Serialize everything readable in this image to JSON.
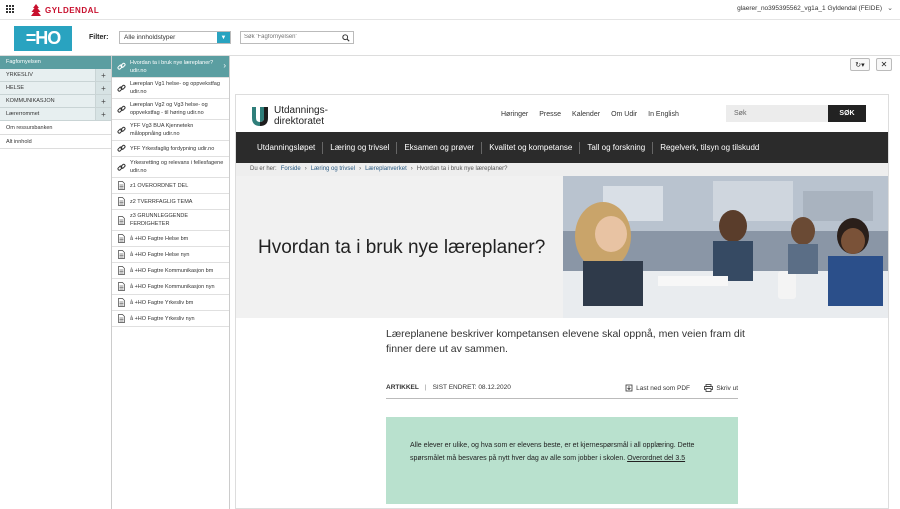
{
  "topbar": {
    "brand": "GYLDENDAL",
    "user": "glaerer_no395395562_vg1a_1 Gyldendal (FEIDE)"
  },
  "filterbar": {
    "logo_text": "=HO",
    "filter_label": "Filter:",
    "filter_value": "Alle innholdstyper",
    "search_placeholder": "Søk 'Fagfornyelsen'"
  },
  "nav": {
    "header": "Fagfornyelsen",
    "groups": [
      {
        "label": "YRKESLIV"
      },
      {
        "label": "HELSE"
      },
      {
        "label": "KOMMUNIKASJON"
      },
      {
        "label": "Lærerrommet"
      }
    ],
    "plain": [
      {
        "label": "Om ressursbanken"
      },
      {
        "label": "Alt innhold"
      }
    ]
  },
  "resources": [
    {
      "label": "Hvordan ta i bruk nye læreplaner? udir.no",
      "icon": "link-icon",
      "active": true
    },
    {
      "label": "Læreplan Vg1 helse- og oppvekstfag udir.no",
      "icon": "link-icon"
    },
    {
      "label": "Læreplan Vg2 og Vg3 helse- og oppvekstfag - til høring udir.no",
      "icon": "link-icon"
    },
    {
      "label": "YFF Vg3 BUA Kjennetekn måloppnåing udir.no",
      "icon": "link-icon"
    },
    {
      "label": "YFF Yrkesfaglig fordypning udir.no",
      "icon": "link-icon"
    },
    {
      "label": "Yrkesretting og relevans i fellesfagene udir.no",
      "icon": "link-icon"
    },
    {
      "label": "z1 OVERORDNET DEL",
      "icon": "document-icon"
    },
    {
      "label": "z2 TVERRFAGLIG TEMA",
      "icon": "document-icon"
    },
    {
      "label": "z3 GRUNNLEGGENDE FERDIGHETER",
      "icon": "document-icon"
    },
    {
      "label": "å +HO Fagtre Helse bm",
      "icon": "document-icon"
    },
    {
      "label": "å +HO Fagtre Helse nyn",
      "icon": "document-icon"
    },
    {
      "label": "å +HO Fagtre Kommunikasjon bm",
      "icon": "document-icon"
    },
    {
      "label": "å +HO Fagtre Kommunikasjon nyn",
      "icon": "document-icon"
    },
    {
      "label": "å +HO Fagtre Yrkesliv bm",
      "icon": "document-icon"
    },
    {
      "label": "å +HO Fagtre Yrkesliv nyn",
      "icon": "document-icon"
    }
  ],
  "udir": {
    "logo_line1": "Utdannings-",
    "logo_line2": "direktoratet",
    "topnav": [
      "Høringer",
      "Presse",
      "Kalender",
      "Om Udir",
      "In English"
    ],
    "search_placeholder": "Søk",
    "search_button": "SØK",
    "mainnav": [
      "Utdanningsløpet",
      "Læring og trivsel",
      "Eksamen og prøver",
      "Kvalitet og kompetanse",
      "Tall og forskning",
      "Regelverk, tilsyn og tilskudd"
    ],
    "breadcrumb_prefix": "Du er her:",
    "breadcrumbs": [
      "Forside",
      "Læring og trivsel",
      "Læreplanverket"
    ],
    "breadcrumb_current": "Hvordan ta i bruk nye læreplaner?",
    "title": "Hvordan ta i bruk nye læreplaner?",
    "ingress": "Læreplanene beskriver kompetansen elevene skal oppnå, men veien fram dit finner dere ut av sammen.",
    "meta_type": "ARTIKKEL",
    "meta_date": "SIST ENDRET: 08.12.2020",
    "download": "Last ned som PDF",
    "print": "Skriv ut",
    "info_text": "Alle elever er ulike, og hva som er elevens beste, er et kjernespørsmål i all opplæring. Dette spørsmålet må besvares på nytt hver dag av alle som jobber i skolen.",
    "info_link": "Overordnet del 3.5"
  }
}
